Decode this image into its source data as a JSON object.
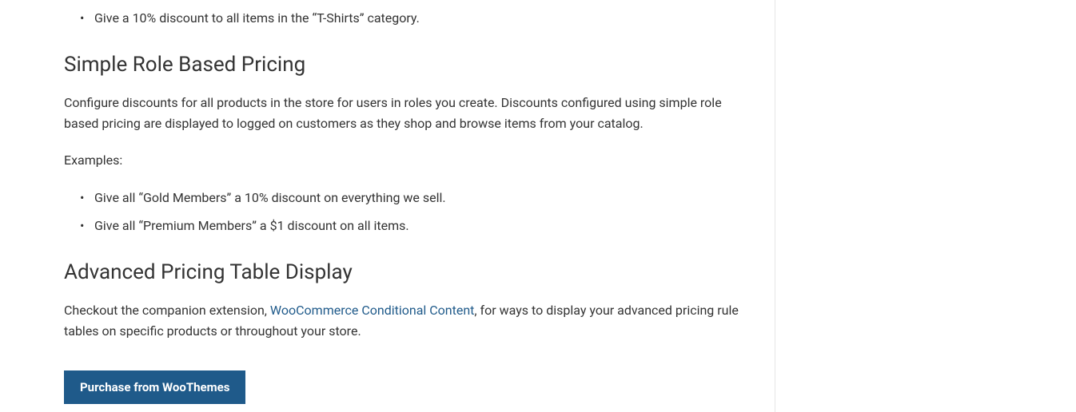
{
  "section1": {
    "list_item1": "Give a 10% discount to all items in the “T-Shirts” category."
  },
  "section2": {
    "heading": "Simple Role Based Pricing",
    "paragraph1": "Configure discounts for all products in the store for users in roles you create. Discounts configured using simple role based pricing are displayed to logged on customers as they shop and browse items from your catalog.",
    "paragraph2": "Examples:",
    "list_item1": "Give all “Gold Members” a 10% discount on everything we sell.",
    "list_item2": "Give all “Premium Members” a $1 discount on all items."
  },
  "section3": {
    "heading": "Advanced Pricing Table Display",
    "paragraph_before_link": "Checkout the companion extension, ",
    "link_text": "WooCommerce Conditional Content",
    "paragraph_after_link": ", for ways to display your advanced pricing rule tables on specific products or throughout your store."
  },
  "cta": {
    "label": "Purchase from WooThemes"
  }
}
